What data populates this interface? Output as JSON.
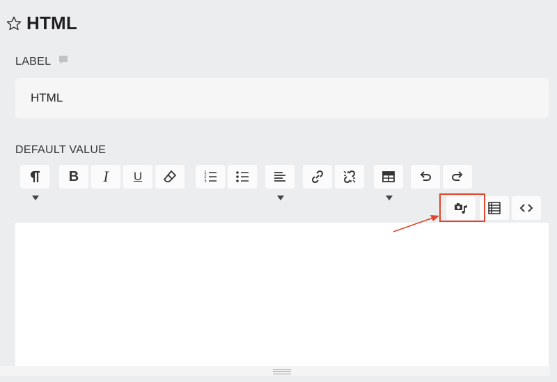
{
  "header": {
    "title": "HTML",
    "star_icon": "star-outline-icon"
  },
  "label_section": {
    "label": "LABEL",
    "comment_icon": "comment-icon",
    "value": "HTML"
  },
  "default_section": {
    "label": "DEFAULT VALUE"
  },
  "toolbar": {
    "paragraph_icon": "paragraph-icon",
    "bold_label": "B",
    "italic_label": "I",
    "underline_label": "U",
    "icons": [
      "paragraph-icon",
      "bold-icon",
      "italic-icon",
      "underline-icon",
      "eraser-icon",
      "ordered-list-icon",
      "unordered-list-icon",
      "align-left-icon",
      "link-icon",
      "unlink-icon",
      "table-icon",
      "undo-icon",
      "redo-icon",
      "insert-media-icon",
      "list-view-icon",
      "code-view-icon"
    ],
    "highlight_color": "#e0462a"
  },
  "annotation": {
    "arrow_color": "#e0462a"
  }
}
